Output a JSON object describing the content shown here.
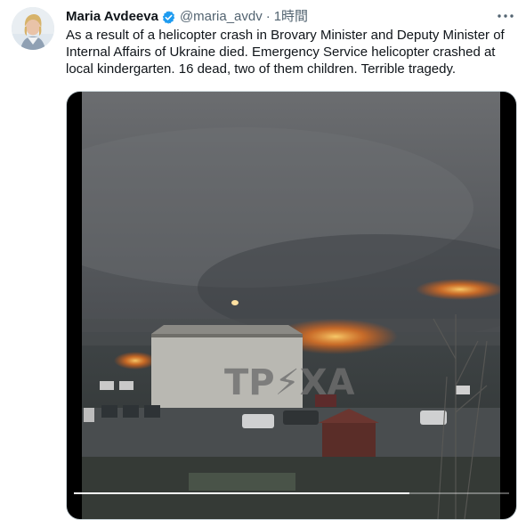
{
  "author": {
    "name": "Maria Avdeeva",
    "handle": "@maria_avdv",
    "time": "1時間"
  },
  "tweet": {
    "text": "As a result of a helicopter crash in Brovary Minister and Deputy Minister of Internal Affairs of Ukraine died. Emergency Service helicopter crashed at local kindergarten. 16 dead, two of them children. Terrible tragedy."
  },
  "media": {
    "watermark": "ТР⚡ХА",
    "progress": 0.77
  },
  "colors": {
    "verified": "#1d9bf0",
    "text_secondary": "#536471",
    "fire": "#ff7a1a"
  },
  "icons": {
    "verified": "verified-badge-icon",
    "more": "more-dots-icon"
  }
}
